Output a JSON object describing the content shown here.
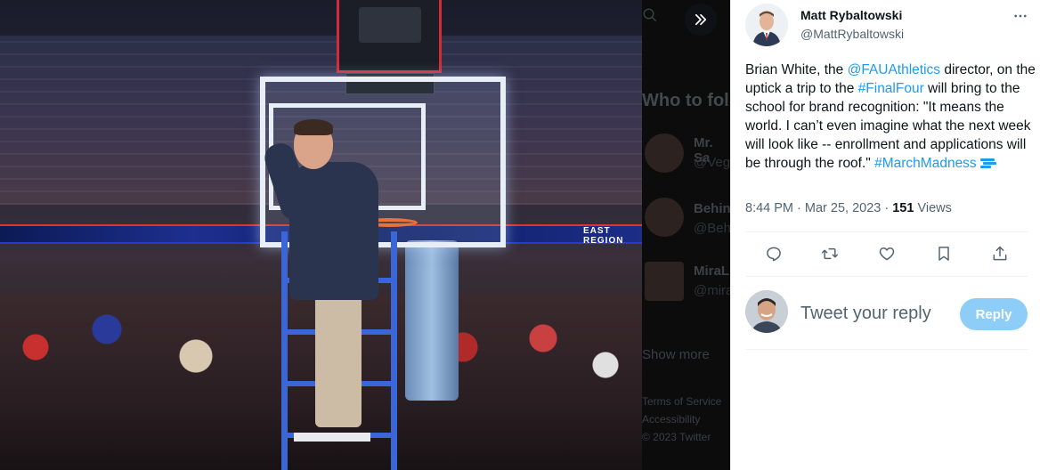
{
  "tweet": {
    "author": {
      "name": "Matt Rybaltowski",
      "handle": "@MattRybaltowski"
    },
    "text_segments": [
      {
        "text": "Brian White, the ",
        "type": "text"
      },
      {
        "text": "@FAUAthletics",
        "type": "link"
      },
      {
        "text": " director, on the uptick a trip to the ",
        "type": "text"
      },
      {
        "text": "#FinalFour",
        "type": "link"
      },
      {
        "text": " will bring to the school for brand recognition: \"It means the world. I can’t even imagine what the next week will look like -- enrollment and applications will be through the roof.\" ",
        "type": "text"
      },
      {
        "text": "#MarchMadness",
        "type": "link"
      }
    ],
    "timestamp": "8:44 PM · Mar 25, 2023",
    "separator": " · ",
    "views_count": "151",
    "views_label": " Views"
  },
  "reply": {
    "placeholder": "Tweet your reply",
    "button_label": "Reply"
  },
  "background": {
    "section_title": "Who to follow",
    "suggestions": [
      {
        "name": "Mr. Sa",
        "handle": "@Veg"
      },
      {
        "name": "Behin",
        "handle": "@Beh"
      },
      {
        "name": "MiraL",
        "handle": "@mira"
      }
    ],
    "show_more": "Show more",
    "footer_1": "Terms of Service",
    "footer_2": "Accessibility",
    "footer_3": "© 2023 Twitter"
  },
  "media": {
    "ribbon_text": "EAST REGION"
  },
  "icons": {
    "expand": "double-chevron-right-icon",
    "more": "more-horizontal-icon",
    "reply": "reply-icon",
    "retweet": "retweet-icon",
    "like": "heart-icon",
    "bookmark": "bookmark-icon",
    "share": "share-icon",
    "hashflag": "march-madness-hashflag-icon"
  },
  "colors": {
    "link": "#1d9bf0",
    "reply_button": "#8ecdf8",
    "secondary_text": "#536471"
  }
}
